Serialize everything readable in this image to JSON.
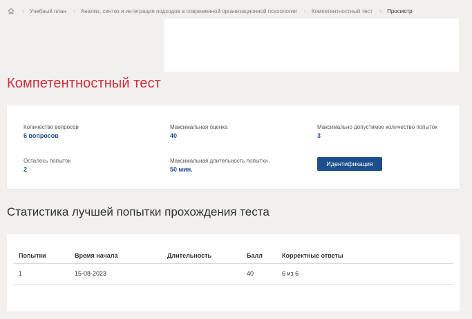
{
  "breadcrumb": {
    "items": [
      "Учебный план",
      "Анализ, синтез и интеграция подходов в современной организационной психологии",
      "Компетентностный тест"
    ],
    "current": "Просмотр"
  },
  "page_title": "Компетентностный тест",
  "info": {
    "questions_label": "Количество вопросов",
    "questions_value": "6 вопросов",
    "max_score_label": "Максимальная оценка",
    "max_score_value": "40",
    "max_attempts_label": "Максимально допустимое количество попыток",
    "max_attempts_value": "3",
    "remaining_label": "Осталось попыток",
    "remaining_value": "2",
    "max_duration_label": "Максимальная длительность попытки",
    "max_duration_value": "50 мин.",
    "identify_button": "Идентификация"
  },
  "stats": {
    "title": "Статистика лучшей попытки прохождения теста",
    "columns": [
      "Попытки",
      "Время начала",
      "Длительность",
      "Балл",
      "Корректные ответы"
    ],
    "rows": [
      [
        "1",
        "15-08-2023",
        "",
        "40",
        "6 из 6"
      ]
    ]
  },
  "colors": {
    "title_red": "#d32d3a",
    "accent_blue": "#1d4f8c",
    "background": "#f1f0ef"
  }
}
